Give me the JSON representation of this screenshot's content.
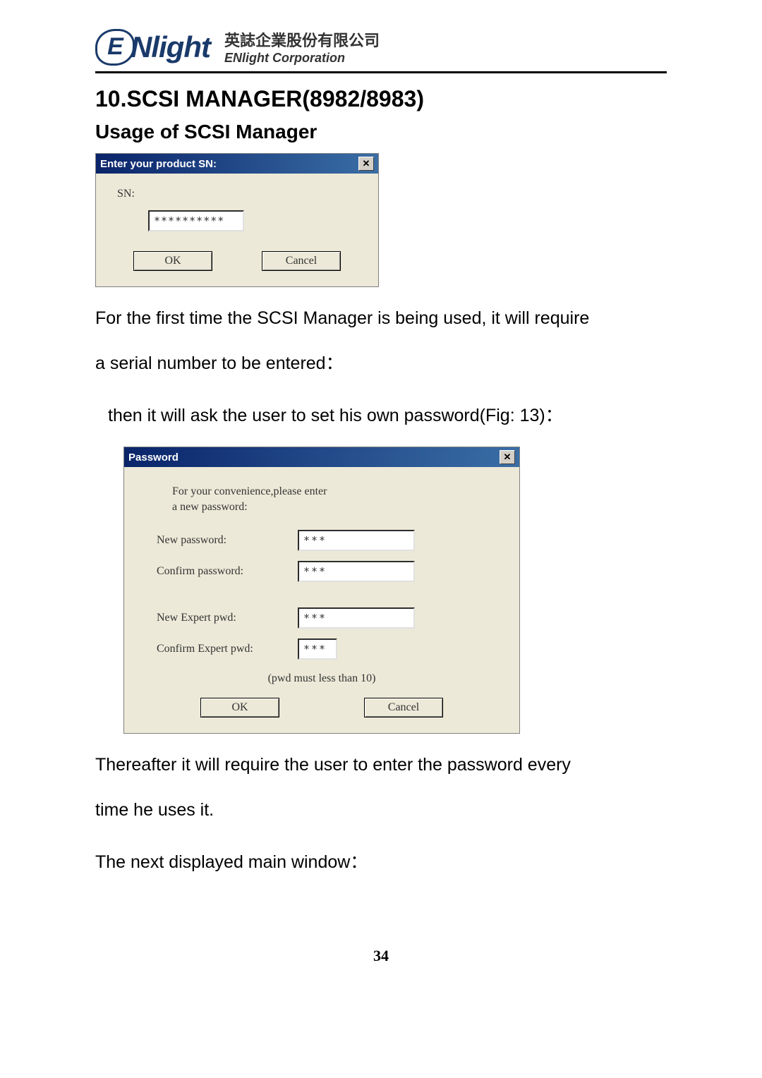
{
  "header": {
    "logo_text": "Nlight",
    "logo_letter": "E",
    "company_cn": "英誌企業股份有限公司",
    "company_en": "ENlight Corporation"
  },
  "headings": {
    "h1": "10.SCSI MANAGER(8982/8983)",
    "h2": "Usage of SCSI Manager"
  },
  "sn_dialog": {
    "title": "Enter your product SN:",
    "label": "SN:",
    "value": "**********",
    "ok": "OK",
    "cancel": "Cancel"
  },
  "paragraphs": {
    "p1a": "For the first time the SCSI Manager is being used, it will require",
    "p1b": "a serial number to be entered：",
    "p2": "then it will ask the user to set his own password(Fig: 13)：",
    "p3a": "Thereafter it will require the user to enter the password every",
    "p3b": "time he uses it.",
    "p4": "The next displayed main window："
  },
  "pw_dialog": {
    "title": "Password",
    "intro": "For your convenience,please enter\na new password:",
    "new_pw_label": "New password:",
    "new_pw_value": "***",
    "confirm_pw_label": "Confirm password:",
    "confirm_pw_value": "***",
    "expert_label": "New Expert pwd:",
    "expert_value": "***",
    "confirm_expert_label": "Confirm Expert pwd:",
    "confirm_expert_value": "***",
    "note": "(pwd must less than 10)",
    "ok": "OK",
    "cancel": "Cancel"
  },
  "page_number": "34"
}
